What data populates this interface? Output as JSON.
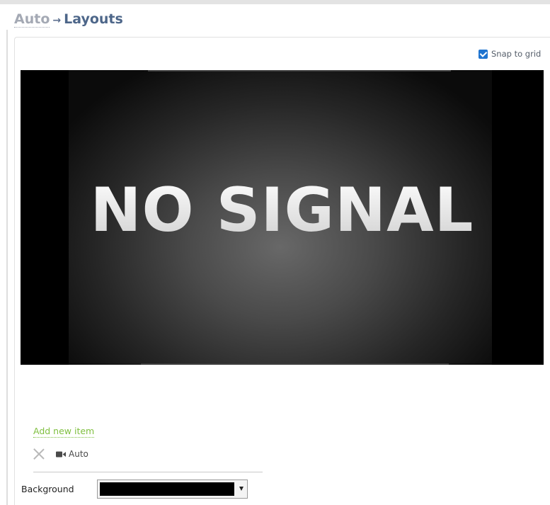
{
  "breadcrumb": {
    "root": "Auto",
    "separator": "→",
    "current": "Layouts"
  },
  "snap_to_grid": {
    "label": "Snap to grid",
    "checked": true
  },
  "preview": {
    "message": "NO SIGNAL"
  },
  "items": {
    "add_label": "Add new item",
    "list": [
      {
        "source_label": "Auto",
        "source_icon": "video-camera-icon",
        "remove_icon": "close-icon"
      }
    ]
  },
  "background": {
    "label": "Background",
    "value_color": "#000000"
  },
  "colors": {
    "link_green": "#7fbf3f",
    "breadcrumb_current": "#4d6689",
    "breadcrumb_root": "#a4a9b4",
    "checkbox_blue": "#1f74d0"
  }
}
